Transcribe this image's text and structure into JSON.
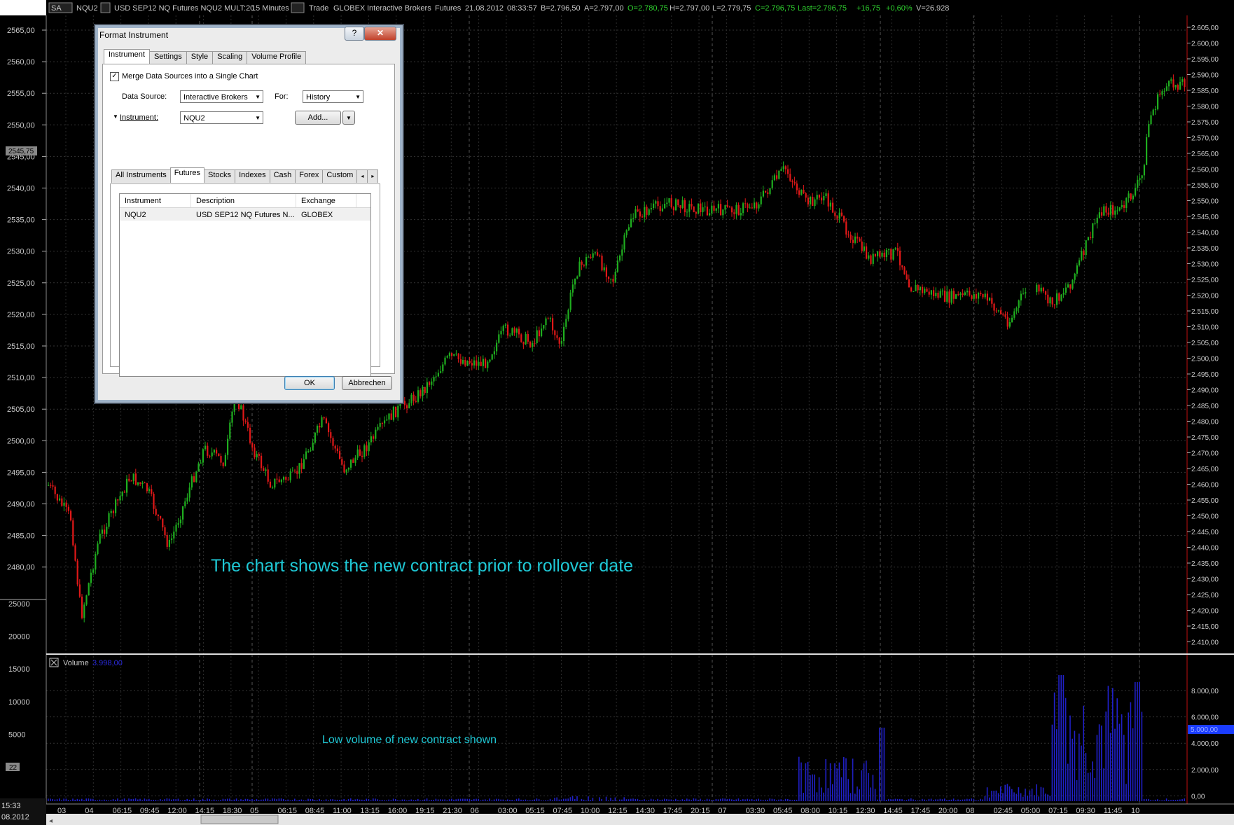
{
  "toolbar": {
    "mode_button": "SA",
    "symbol": "NQU2",
    "description": "USD SEP12 NQ Futures NQU2 MULT:20",
    "interval": "15 Minutes",
    "trade_label": "Trade",
    "exchange": "GLOBEX",
    "source": "Interactive Brokers",
    "type": "Futures",
    "date": "21.08.2012",
    "time": "08:33:57",
    "bid": "B=2.796,50",
    "ask": "A=2.797,00",
    "open": "O=2.780,75",
    "high": "H=2.797,00",
    "low": "L=2.779,75",
    "close": "C=2.796,75",
    "last": "Last=2.796,75",
    "change": "+16,75",
    "change_pct": "+0,60%",
    "volume": "V=26.928",
    "colors": {
      "green": "#2fd12f",
      "text": "#c8c8c8"
    }
  },
  "left_axis": {
    "price_ticks": [
      "2565,00",
      "2560,00",
      "2555,00",
      "2550,00",
      "2545,00",
      "2540,00",
      "2535,00",
      "2530,00",
      "2525,00",
      "2520,00",
      "2515,00",
      "2510,00",
      "2505,00",
      "2500,00",
      "2495,00",
      "2490,00",
      "2485,00",
      "2480,00"
    ],
    "price_marker": "2545,75",
    "volume_ticks": [
      "25000",
      "20000",
      "15000",
      "10000",
      "5000"
    ],
    "volume_marker": "22",
    "clock_time": "15:33",
    "clock_date": "08.2012"
  },
  "right_axis": {
    "price_ticks": [
      "2.605,00",
      "2.600,00",
      "2.595,00",
      "2.590,00",
      "2.585,00",
      "2.580,00",
      "2.575,00",
      "2.570,00",
      "2.565,00",
      "2.560,00",
      "2.555,00",
      "2.550,00",
      "2.545,00",
      "2.540,00",
      "2.535,00",
      "2.530,00",
      "2.525,00",
      "2.520,00",
      "2.515,00",
      "2.510,00",
      "2.505,00",
      "2.500,00",
      "2.495,00",
      "2.490,00",
      "2.485,00",
      "2.480,00",
      "2.475,00",
      "2.470,00",
      "2.465,00",
      "2.460,00",
      "2.455,00",
      "2.450,00",
      "2.445,00",
      "2.440,00",
      "2.435,00",
      "2.430,00",
      "2.425,00",
      "2.420,00",
      "2.415,00",
      "2.410,00"
    ],
    "volume_ticks": [
      "8.000,00",
      "6.000,00",
      "4.000,00",
      "2.000,00",
      "0,00"
    ],
    "volume_marker": "5.000,00"
  },
  "time_axis": [
    "03",
    "04",
    "06:15",
    "09:45",
    "12:00",
    "14:15",
    "18:30",
    "05",
    "06:15",
    "08:45",
    "11:00",
    "13:15",
    "16:00",
    "19:15",
    "21:30",
    "06",
    "03:00",
    "05:15",
    "07:45",
    "10:00",
    "12:15",
    "14:30",
    "17:45",
    "20:15",
    "07",
    "03:30",
    "05:45",
    "08:00",
    "10:15",
    "12:30",
    "14:45",
    "17:45",
    "20:00",
    "08",
    "02:45",
    "05:00",
    "07:15",
    "09:30",
    "11:45",
    "10"
  ],
  "volume_pane": {
    "title": "Volume",
    "value": "3.998,00"
  },
  "annotations": {
    "price": "The chart shows the new contract prior to rollover date",
    "volume": "Low volume of new contract shown",
    "color": "#1fc9d6"
  },
  "candle_colors": {
    "up": "#1fae1f",
    "down": "#e01818"
  },
  "dialog": {
    "title": "Format Instrument",
    "help": "?",
    "close": "✕",
    "tabs": [
      "Instrument",
      "Settings",
      "Style",
      "Scaling",
      "Volume Profile"
    ],
    "merge_label": "Merge Data Sources into a Single Chart",
    "merge_checked": true,
    "data_source_label": "Data Source:",
    "data_source_value": "Interactive Brokers",
    "for_label": "For:",
    "for_value": "History",
    "instrument_label": "Instrument:",
    "instrument_value": "NQU2",
    "add_button": "Add...",
    "subtabs": [
      "All Instruments",
      "Futures",
      "Stocks",
      "Indexes",
      "Cash",
      "Forex",
      "Custom"
    ],
    "grid": {
      "columns": [
        "Instrument",
        "Description",
        "Exchange"
      ],
      "rows": [
        [
          "NQU2",
          "USD SEP12 NQ Futures N...",
          "GLOBEX"
        ]
      ]
    },
    "ok_button": "OK",
    "cancel_button": "Abbrechen"
  }
}
